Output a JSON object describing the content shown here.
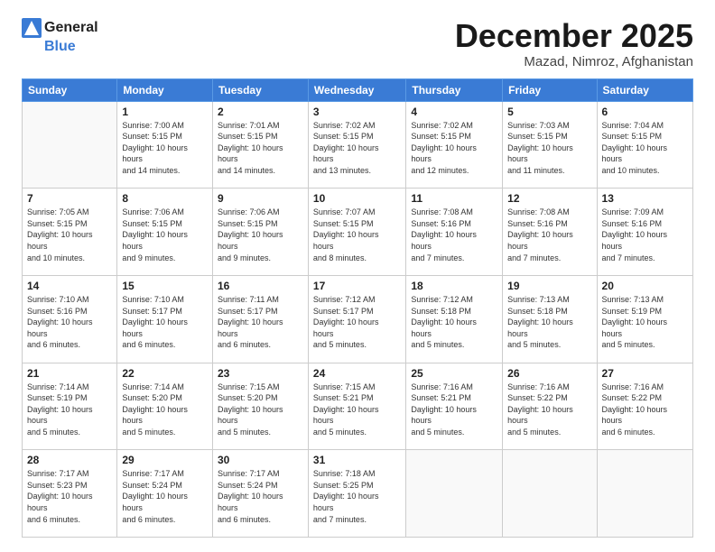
{
  "header": {
    "logo_line1": "General",
    "logo_line2": "Blue",
    "month_title": "December 2025",
    "location": "Mazad, Nimroz, Afghanistan"
  },
  "days_of_week": [
    "Sunday",
    "Monday",
    "Tuesday",
    "Wednesday",
    "Thursday",
    "Friday",
    "Saturday"
  ],
  "weeks": [
    [
      null,
      {
        "day": 1,
        "sunrise": "7:00 AM",
        "sunset": "5:15 PM",
        "daylight": "10 hours and 14 minutes."
      },
      {
        "day": 2,
        "sunrise": "7:01 AM",
        "sunset": "5:15 PM",
        "daylight": "10 hours and 14 minutes."
      },
      {
        "day": 3,
        "sunrise": "7:02 AM",
        "sunset": "5:15 PM",
        "daylight": "10 hours and 13 minutes."
      },
      {
        "day": 4,
        "sunrise": "7:02 AM",
        "sunset": "5:15 PM",
        "daylight": "10 hours and 12 minutes."
      },
      {
        "day": 5,
        "sunrise": "7:03 AM",
        "sunset": "5:15 PM",
        "daylight": "10 hours and 11 minutes."
      },
      {
        "day": 6,
        "sunrise": "7:04 AM",
        "sunset": "5:15 PM",
        "daylight": "10 hours and 10 minutes."
      }
    ],
    [
      {
        "day": 7,
        "sunrise": "7:05 AM",
        "sunset": "5:15 PM",
        "daylight": "10 hours and 10 minutes."
      },
      {
        "day": 8,
        "sunrise": "7:06 AM",
        "sunset": "5:15 PM",
        "daylight": "10 hours and 9 minutes."
      },
      {
        "day": 9,
        "sunrise": "7:06 AM",
        "sunset": "5:15 PM",
        "daylight": "10 hours and 9 minutes."
      },
      {
        "day": 10,
        "sunrise": "7:07 AM",
        "sunset": "5:15 PM",
        "daylight": "10 hours and 8 minutes."
      },
      {
        "day": 11,
        "sunrise": "7:08 AM",
        "sunset": "5:16 PM",
        "daylight": "10 hours and 7 minutes."
      },
      {
        "day": 12,
        "sunrise": "7:08 AM",
        "sunset": "5:16 PM",
        "daylight": "10 hours and 7 minutes."
      },
      {
        "day": 13,
        "sunrise": "7:09 AM",
        "sunset": "5:16 PM",
        "daylight": "10 hours and 7 minutes."
      }
    ],
    [
      {
        "day": 14,
        "sunrise": "7:10 AM",
        "sunset": "5:16 PM",
        "daylight": "10 hours and 6 minutes."
      },
      {
        "day": 15,
        "sunrise": "7:10 AM",
        "sunset": "5:17 PM",
        "daylight": "10 hours and 6 minutes."
      },
      {
        "day": 16,
        "sunrise": "7:11 AM",
        "sunset": "5:17 PM",
        "daylight": "10 hours and 6 minutes."
      },
      {
        "day": 17,
        "sunrise": "7:12 AM",
        "sunset": "5:17 PM",
        "daylight": "10 hours and 5 minutes."
      },
      {
        "day": 18,
        "sunrise": "7:12 AM",
        "sunset": "5:18 PM",
        "daylight": "10 hours and 5 minutes."
      },
      {
        "day": 19,
        "sunrise": "7:13 AM",
        "sunset": "5:18 PM",
        "daylight": "10 hours and 5 minutes."
      },
      {
        "day": 20,
        "sunrise": "7:13 AM",
        "sunset": "5:19 PM",
        "daylight": "10 hours and 5 minutes."
      }
    ],
    [
      {
        "day": 21,
        "sunrise": "7:14 AM",
        "sunset": "5:19 PM",
        "daylight": "10 hours and 5 minutes."
      },
      {
        "day": 22,
        "sunrise": "7:14 AM",
        "sunset": "5:20 PM",
        "daylight": "10 hours and 5 minutes."
      },
      {
        "day": 23,
        "sunrise": "7:15 AM",
        "sunset": "5:20 PM",
        "daylight": "10 hours and 5 minutes."
      },
      {
        "day": 24,
        "sunrise": "7:15 AM",
        "sunset": "5:21 PM",
        "daylight": "10 hours and 5 minutes."
      },
      {
        "day": 25,
        "sunrise": "7:16 AM",
        "sunset": "5:21 PM",
        "daylight": "10 hours and 5 minutes."
      },
      {
        "day": 26,
        "sunrise": "7:16 AM",
        "sunset": "5:22 PM",
        "daylight": "10 hours and 5 minutes."
      },
      {
        "day": 27,
        "sunrise": "7:16 AM",
        "sunset": "5:22 PM",
        "daylight": "10 hours and 6 minutes."
      }
    ],
    [
      {
        "day": 28,
        "sunrise": "7:17 AM",
        "sunset": "5:23 PM",
        "daylight": "10 hours and 6 minutes."
      },
      {
        "day": 29,
        "sunrise": "7:17 AM",
        "sunset": "5:24 PM",
        "daylight": "10 hours and 6 minutes."
      },
      {
        "day": 30,
        "sunrise": "7:17 AM",
        "sunset": "5:24 PM",
        "daylight": "10 hours and 6 minutes."
      },
      {
        "day": 31,
        "sunrise": "7:18 AM",
        "sunset": "5:25 PM",
        "daylight": "10 hours and 7 minutes."
      },
      null,
      null,
      null
    ]
  ],
  "labels": {
    "sunrise": "Sunrise:",
    "sunset": "Sunset:",
    "daylight": "Daylight:"
  }
}
